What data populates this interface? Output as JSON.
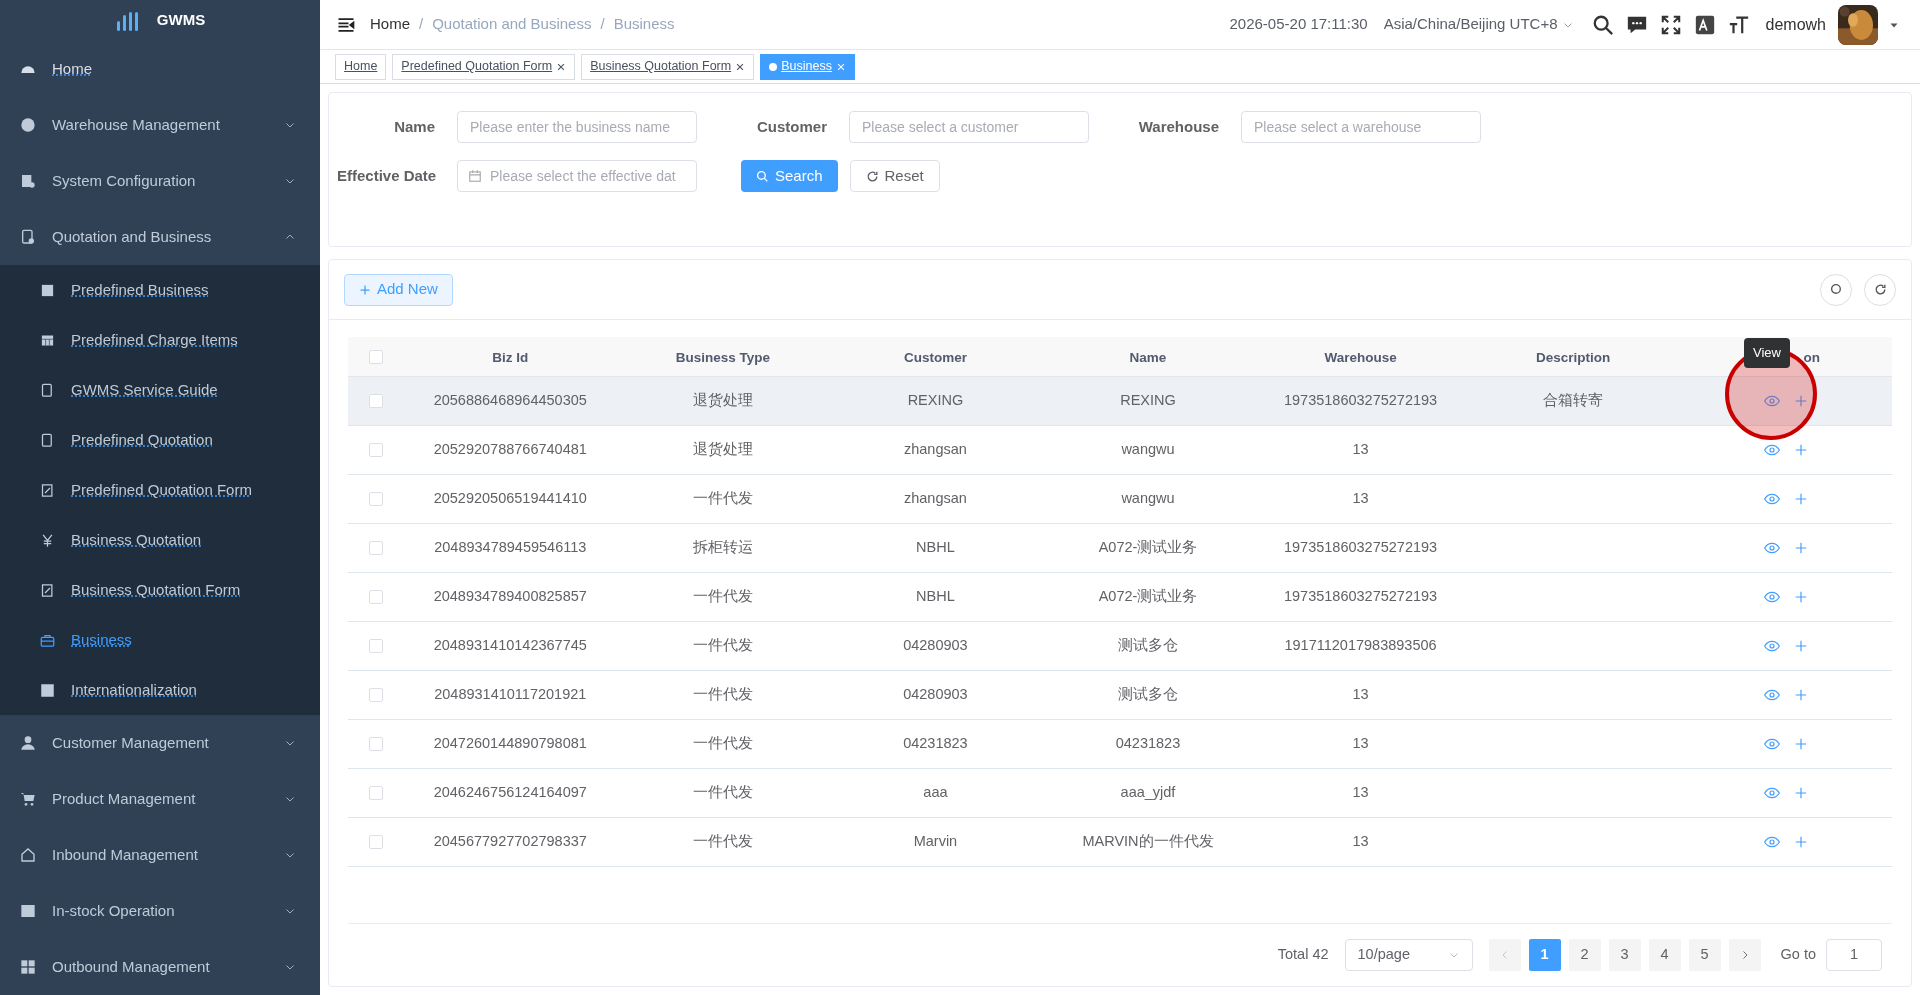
{
  "sidebar": {
    "logo": "GWMS",
    "items": [
      {
        "label": "Home",
        "kind": "link"
      },
      {
        "label": "Warehouse Management",
        "kind": "group",
        "expanded": false
      },
      {
        "label": "System Configuration",
        "kind": "group",
        "expanded": false
      },
      {
        "label": "Quotation and Business",
        "kind": "group",
        "expanded": true,
        "children": [
          {
            "label": "Predefined Business",
            "selected": false
          },
          {
            "label": "Predefined Charge Items",
            "selected": false
          },
          {
            "label": "GWMS Service Guide",
            "selected": false
          },
          {
            "label": "Predefined Quotation",
            "selected": false
          },
          {
            "label": "Predefined Quotation Form",
            "selected": false
          },
          {
            "label": "Business Quotation",
            "selected": false
          },
          {
            "label": "Business Quotation Form",
            "selected": false
          },
          {
            "label": "Business",
            "selected": true
          },
          {
            "label": "Internationalization",
            "selected": false
          }
        ]
      },
      {
        "label": "Customer Management",
        "kind": "group",
        "expanded": false
      },
      {
        "label": "Product Management",
        "kind": "group",
        "expanded": false
      },
      {
        "label": "Inbound Management",
        "kind": "group",
        "expanded": false
      },
      {
        "label": "In-stock Operation",
        "kind": "group",
        "expanded": false
      },
      {
        "label": "Outbound Management",
        "kind": "group",
        "expanded": false
      }
    ]
  },
  "topbar": {
    "breadcrumb": [
      "Home",
      "Quotation and Business",
      "Business"
    ],
    "breadcrumb_separator": "/",
    "datetime": "2026-05-20 17:11:30",
    "timezone": "Asia/China/Beijing UTC+8",
    "username": "demowh"
  },
  "tabs": [
    {
      "label": "Home",
      "selected": false,
      "closable": false
    },
    {
      "label": "Predefined Quotation Form",
      "selected": false,
      "closable": true
    },
    {
      "label": "Business Quotation Form",
      "selected": false,
      "closable": true
    },
    {
      "label": "Business",
      "selected": true,
      "closable": true
    }
  ],
  "search_form": {
    "fields": [
      {
        "label": "Name",
        "placeholder": "Please enter the business name",
        "kind": "text"
      },
      {
        "label": "Customer",
        "placeholder": "Please select a customer",
        "kind": "text"
      },
      {
        "label": "Warehouse",
        "placeholder": "Please select a warehouse",
        "kind": "text"
      },
      {
        "label": "Effective Date",
        "placeholder": "Please select the effective dat",
        "kind": "date"
      }
    ],
    "search_button": "Search",
    "reset_button": "Reset"
  },
  "toolbar": {
    "add_button": "Add New"
  },
  "table": {
    "header_checked": false,
    "columns": [
      "Biz Id",
      "Business Type",
      "Customer",
      "Name",
      "Warehouse",
      "Description",
      "on"
    ],
    "rows": [
      {
        "checked": false,
        "hovered": true,
        "cells": [
          "2056886468964450305",
          "退货处理",
          "REXING",
          "REXING",
          "1973518603275272193",
          "合箱转寄"
        ]
      },
      {
        "checked": false,
        "hovered": false,
        "cells": [
          "2052920788766740481",
          "退货处理",
          "zhangsan",
          "wangwu",
          "13",
          ""
        ]
      },
      {
        "checked": false,
        "hovered": false,
        "cells": [
          "2052920506519441410",
          "一件代发",
          "zhangsan",
          "wangwu",
          "13",
          ""
        ]
      },
      {
        "checked": false,
        "hovered": false,
        "cells": [
          "2048934789459546113",
          "拆柜转运",
          "NBHL",
          "A072-测试业务",
          "1973518603275272193",
          ""
        ]
      },
      {
        "checked": false,
        "hovered": false,
        "cells": [
          "2048934789400825857",
          "一件代发",
          "NBHL",
          "A072-测试业务",
          "1973518603275272193",
          ""
        ]
      },
      {
        "checked": false,
        "hovered": false,
        "cells": [
          "2048931410142367745",
          "一件代发",
          "04280903",
          "测试多仓",
          "1917112017983893506",
          ""
        ]
      },
      {
        "checked": false,
        "hovered": false,
        "cells": [
          "2048931410117201921",
          "一件代发",
          "04280903",
          "测试多仓",
          "13",
          ""
        ]
      },
      {
        "checked": false,
        "hovered": false,
        "cells": [
          "2047260144890798081",
          "一件代发",
          "04231823",
          "04231823",
          "13",
          ""
        ]
      },
      {
        "checked": false,
        "hovered": false,
        "cells": [
          "2046246756124164097",
          "一件代发",
          "aaa",
          "aaa_yjdf",
          "13",
          ""
        ]
      },
      {
        "checked": false,
        "hovered": false,
        "cells": [
          "2045677927702798337",
          "一件代发",
          "Marvin",
          "MARVIN的一件代发",
          "13",
          ""
        ]
      }
    ]
  },
  "tooltip": "View",
  "pagination": {
    "total": "Total 42",
    "page_size": "10/page",
    "prev_disabled": true,
    "pages": [
      {
        "label": "1",
        "selected": true
      },
      {
        "label": "2",
        "selected": false
      },
      {
        "label": "3",
        "selected": false
      },
      {
        "label": "4",
        "selected": false
      },
      {
        "label": "5",
        "selected": false
      }
    ],
    "goto_label": "Go to",
    "goto_value": "1"
  }
}
